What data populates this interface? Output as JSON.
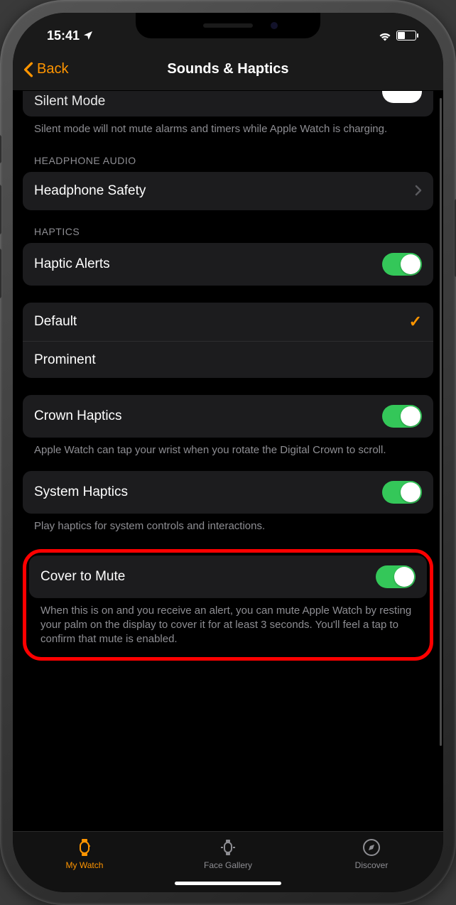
{
  "status": {
    "time": "15:41"
  },
  "nav": {
    "back": "Back",
    "title": "Sounds & Haptics"
  },
  "silent_mode": {
    "label": "Silent Mode",
    "footer": "Silent mode will not mute alarms and timers while Apple Watch is charging."
  },
  "headphone": {
    "header": "HEADPHONE AUDIO",
    "safety_label": "Headphone Safety"
  },
  "haptics": {
    "header": "HAPTICS",
    "alerts_label": "Haptic Alerts",
    "default_label": "Default",
    "prominent_label": "Prominent",
    "crown_label": "Crown Haptics",
    "crown_footer": "Apple Watch can tap your wrist when you rotate the Digital Crown to scroll.",
    "system_label": "System Haptics",
    "system_footer": "Play haptics for system controls and interactions."
  },
  "cover": {
    "label": "Cover to Mute",
    "footer": "When this is on and you receive an alert, you can mute Apple Watch by resting your palm on the display to cover it for at least 3 seconds. You'll feel a tap to confirm that mute is enabled."
  },
  "tabs": {
    "my_watch": "My Watch",
    "face_gallery": "Face Gallery",
    "discover": "Discover"
  }
}
